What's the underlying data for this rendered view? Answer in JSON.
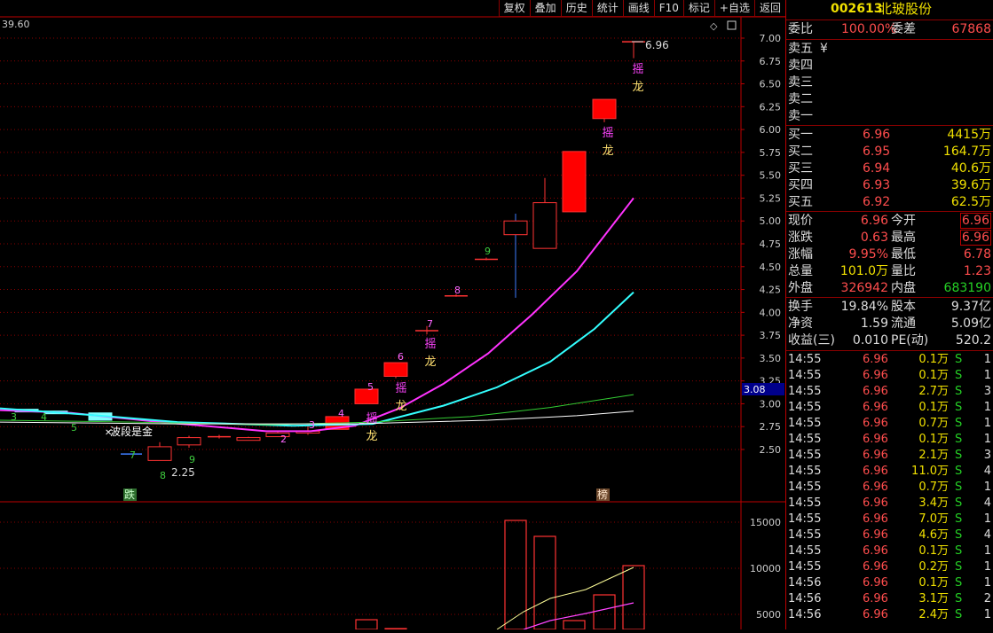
{
  "toolbar": [
    "复权",
    "叠加",
    "历史",
    "统计",
    "画线",
    "F10",
    "标记",
    "+自选",
    "返回"
  ],
  "stock": {
    "code": "002613",
    "name": "北玻股份"
  },
  "chart": {
    "top_left_value": "39.60",
    "price_axis": [
      "7.00",
      "6.75",
      "6.50",
      "6.25",
      "6.00",
      "5.75",
      "5.50",
      "5.25",
      "5.00",
      "4.75",
      "4.50",
      "4.25",
      "4.00",
      "3.75",
      "3.50",
      "3.25",
      "3.00",
      "2.75",
      "2.50"
    ],
    "price_tag": "3.08",
    "volume_axis": [
      "15000",
      "10000",
      "5000"
    ],
    "high_label": "6.96",
    "low_label": "2.25",
    "annotation": "波段是金",
    "bottom_label_left": "跌",
    "bottom_label_right": "榜",
    "seq_numbers": [
      "3",
      "4",
      "5",
      "7",
      "8",
      "9",
      "1",
      "2",
      "3",
      "4",
      "5",
      "6",
      "7",
      "8",
      "9"
    ],
    "dragon_top": "摇",
    "dragon_bottom": "龙"
  },
  "panel": {
    "weibi_label": "委比",
    "weibi_value": "100.00%",
    "weicha_label": "委差",
    "weicha_value": "67868",
    "sell": [
      {
        "label": "卖五",
        "price": "¥"
      },
      {
        "label": "卖四",
        "price": ""
      },
      {
        "label": "卖三",
        "price": ""
      },
      {
        "label": "卖二",
        "price": ""
      },
      {
        "label": "卖一",
        "price": ""
      }
    ],
    "buy": [
      {
        "label": "买一",
        "price": "6.96",
        "vol": "4415万"
      },
      {
        "label": "买二",
        "price": "6.95",
        "vol": "164.7万"
      },
      {
        "label": "买三",
        "price": "6.94",
        "vol": "40.6万"
      },
      {
        "label": "买四",
        "price": "6.93",
        "vol": "39.6万"
      },
      {
        "label": "买五",
        "price": "6.92",
        "vol": "62.5万"
      }
    ],
    "stats": [
      {
        "l1": "现价",
        "v1": "6.96",
        "l2": "今开",
        "v2": "6.96"
      },
      {
        "l1": "涨跌",
        "v1": "0.63",
        "l2": "最高",
        "v2": "6.96"
      },
      {
        "l1": "涨幅",
        "v1": "9.95%",
        "l2": "最低",
        "v2": "6.78"
      },
      {
        "l1": "总量",
        "v1": "101.0万",
        "l2": "量比",
        "v2": "1.23"
      },
      {
        "l1": "外盘",
        "v1": "326942",
        "l2": "内盘",
        "v2": "683190"
      }
    ],
    "stats2": [
      {
        "l1": "换手",
        "v1": "19.84%",
        "l2": "股本",
        "v2": "9.37亿"
      },
      {
        "l1": "净资",
        "v1": "1.59",
        "l2": "流通",
        "v2": "5.09亿"
      },
      {
        "l1": "收益(三)",
        "v1": "0.010",
        "l2": "PE(动)",
        "v2": "520.2"
      }
    ],
    "trades": [
      {
        "time": "14:55",
        "price": "6.96",
        "vol": "0.1万",
        "bs": "S",
        "n": "1"
      },
      {
        "time": "14:55",
        "price": "6.96",
        "vol": "0.1万",
        "bs": "S",
        "n": "1"
      },
      {
        "time": "14:55",
        "price": "6.96",
        "vol": "2.7万",
        "bs": "S",
        "n": "3"
      },
      {
        "time": "14:55",
        "price": "6.96",
        "vol": "0.1万",
        "bs": "S",
        "n": "1"
      },
      {
        "time": "14:55",
        "price": "6.96",
        "vol": "0.7万",
        "bs": "S",
        "n": "1"
      },
      {
        "time": "14:55",
        "price": "6.96",
        "vol": "0.1万",
        "bs": "S",
        "n": "1"
      },
      {
        "time": "14:55",
        "price": "6.96",
        "vol": "2.1万",
        "bs": "S",
        "n": "3"
      },
      {
        "time": "14:55",
        "price": "6.96",
        "vol": "11.0万",
        "bs": "S",
        "n": "4"
      },
      {
        "time": "14:55",
        "price": "6.96",
        "vol": "0.7万",
        "bs": "S",
        "n": "1"
      },
      {
        "time": "14:55",
        "price": "6.96",
        "vol": "3.4万",
        "bs": "S",
        "n": "4"
      },
      {
        "time": "14:55",
        "price": "6.96",
        "vol": "7.0万",
        "bs": "S",
        "n": "1"
      },
      {
        "time": "14:55",
        "price": "6.96",
        "vol": "4.6万",
        "bs": "S",
        "n": "4"
      },
      {
        "time": "14:55",
        "price": "6.96",
        "vol": "0.1万",
        "bs": "S",
        "n": "1"
      },
      {
        "time": "14:55",
        "price": "6.96",
        "vol": "0.2万",
        "bs": "S",
        "n": "1"
      },
      {
        "time": "14:56",
        "price": "6.96",
        "vol": "0.1万",
        "bs": "S",
        "n": "1"
      },
      {
        "time": "14:56",
        "price": "6.96",
        "vol": "3.1万",
        "bs": "S",
        "n": "2"
      },
      {
        "time": "14:56",
        "price": "6.96",
        "vol": "2.4万",
        "bs": "S",
        "n": "1"
      }
    ]
  },
  "colors": {
    "up": "#ff0000",
    "down": "#3ec8ff",
    "ma5": "#ffffff",
    "ma10": "#ffff66",
    "ma20": "#ff33ff",
    "ma30": "#33ffff",
    "ma60": "#33cc33",
    "grid": "#8b0000"
  }
}
